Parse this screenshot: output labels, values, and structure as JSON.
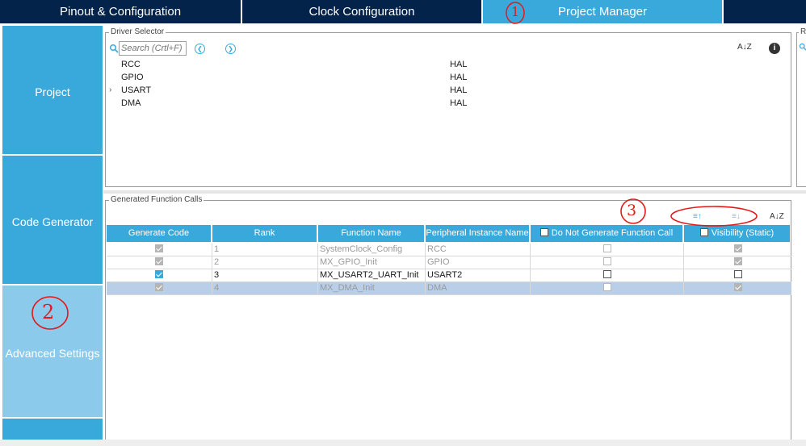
{
  "tabs": [
    {
      "label": "Pinout & Configuration"
    },
    {
      "label": "Clock Configuration"
    },
    {
      "label": "Project Manager"
    },
    {
      "label": ""
    }
  ],
  "sidebar": {
    "items": [
      {
        "label": "Project"
      },
      {
        "label": "Code Generator"
      },
      {
        "label": "Advanced Settings"
      }
    ]
  },
  "driver_selector": {
    "legend": "Driver Selector",
    "search_placeholder": "Search (Crtl+F)",
    "rows": [
      {
        "name": "RCC",
        "driver": "HAL",
        "expander": ""
      },
      {
        "name": "GPIO",
        "driver": "HAL",
        "expander": ""
      },
      {
        "name": "USART",
        "driver": "HAL",
        "expander": "›"
      },
      {
        "name": "DMA",
        "driver": "HAL",
        "expander": ""
      }
    ]
  },
  "right_panel": {
    "legend": "R"
  },
  "generated_calls": {
    "legend": "Generated Function Calls",
    "columns": [
      {
        "label": "Generate Code"
      },
      {
        "label": "Rank"
      },
      {
        "label": "Function Name"
      },
      {
        "label": "Peripheral Instance Name"
      },
      {
        "label": "Do Not Generate Function Call"
      },
      {
        "label": "Visibility (Static)"
      }
    ],
    "rows": [
      {
        "generate": "checked-grey",
        "rank": "1",
        "function": "SystemClock_Config",
        "instance": "RCC",
        "no_call": "disabled",
        "visibility": "checked-grey",
        "state": "dim"
      },
      {
        "generate": "checked-grey",
        "rank": "2",
        "function": "MX_GPIO_Init",
        "instance": "GPIO",
        "no_call": "disabled",
        "visibility": "checked-grey",
        "state": "dim"
      },
      {
        "generate": "checked-blue",
        "rank": "3",
        "function": "MX_USART2_UART_Init",
        "instance": "USART2",
        "no_call": "unchecked",
        "visibility": "unchecked",
        "state": "normal"
      },
      {
        "generate": "checked-grey",
        "rank": "4",
        "function": "MX_DMA_Init",
        "instance": "DMA",
        "no_call": "disabled",
        "visibility": "checked-grey",
        "state": "selected"
      }
    ]
  },
  "annotations": [
    "1",
    "2",
    "3"
  ],
  "colors": {
    "accent": "#39a9dc",
    "dark": "#03234b",
    "annotation": "#e31a1a"
  }
}
